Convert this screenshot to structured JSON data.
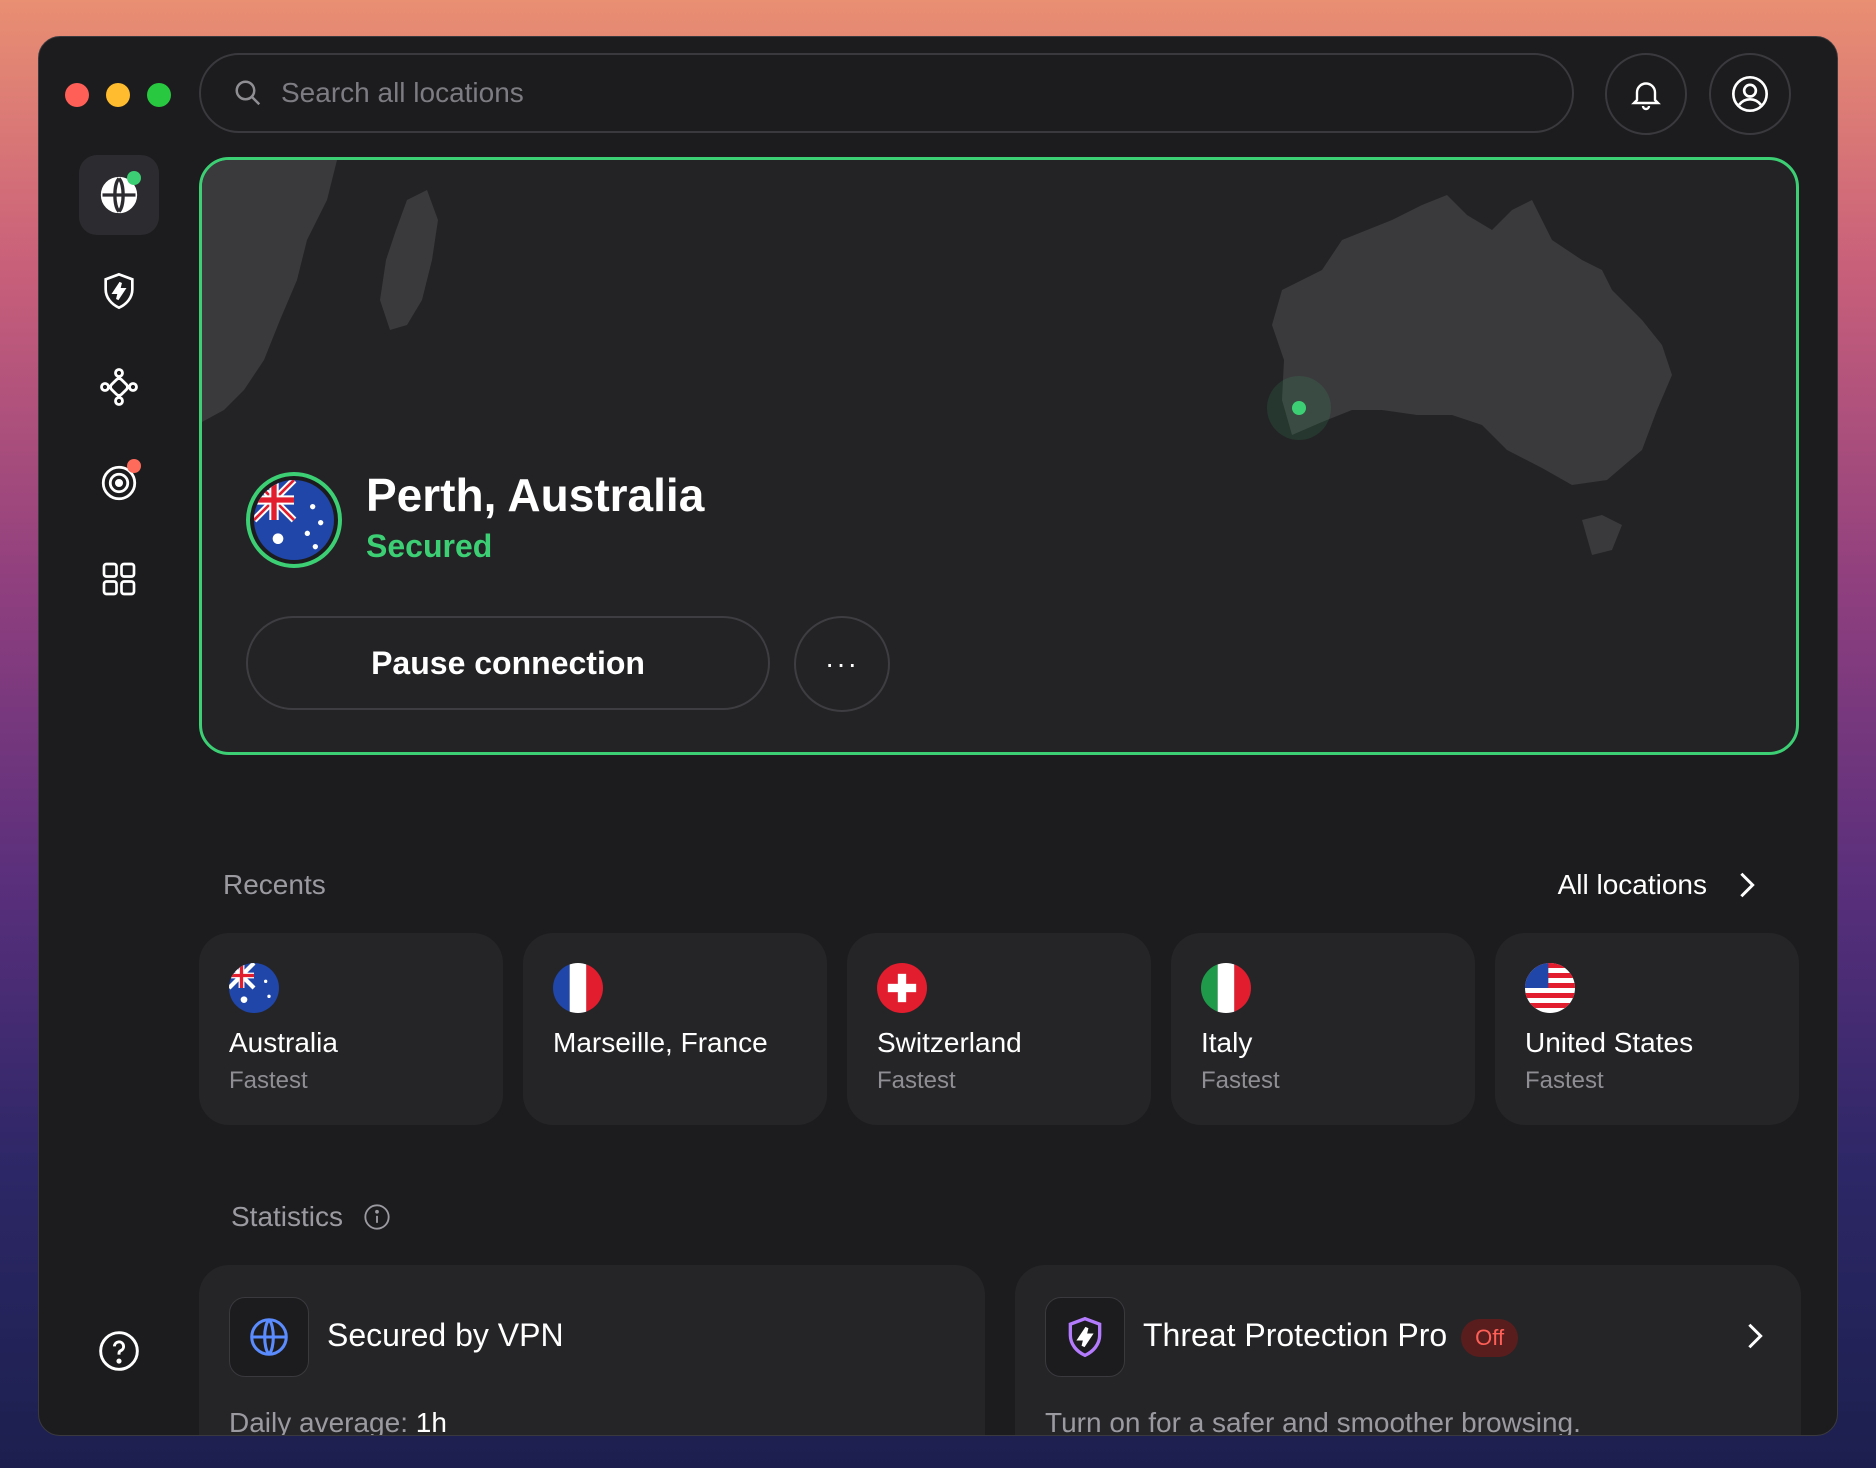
{
  "search": {
    "placeholder": "Search all locations"
  },
  "sidebar": {
    "items": [
      {
        "name": "globe-icon",
        "active": true
      },
      {
        "name": "shield-bolt-icon"
      },
      {
        "name": "meshnet-icon"
      },
      {
        "name": "target-icon"
      },
      {
        "name": "grid-icon"
      }
    ]
  },
  "hero": {
    "location": "Perth, Australia",
    "status": "Secured",
    "pause_label": "Pause connection",
    "more_label": "···"
  },
  "recents": {
    "title": "Recents",
    "all_locations_label": "All locations",
    "items": [
      {
        "name": "Australia",
        "sub": "Fastest",
        "flag": "au"
      },
      {
        "name": "Marseille, France",
        "sub": "",
        "flag": "fr"
      },
      {
        "name": "Switzerland",
        "sub": "Fastest",
        "flag": "ch"
      },
      {
        "name": "Italy",
        "sub": "Fastest",
        "flag": "it"
      },
      {
        "name": "United States",
        "sub": "Fastest",
        "flag": "us"
      }
    ]
  },
  "statistics": {
    "title": "Statistics",
    "vpn": {
      "title": "Secured by VPN",
      "sub_label": "Daily average:",
      "sub_value": "1h"
    },
    "threat": {
      "title": "Threat Protection Pro",
      "badge": "Off",
      "sub": "Turn on for a safer and smoother browsing."
    }
  },
  "colors": {
    "accent": "#3ccf74",
    "off": "#ff5f57",
    "background": "#1c1c1e"
  }
}
